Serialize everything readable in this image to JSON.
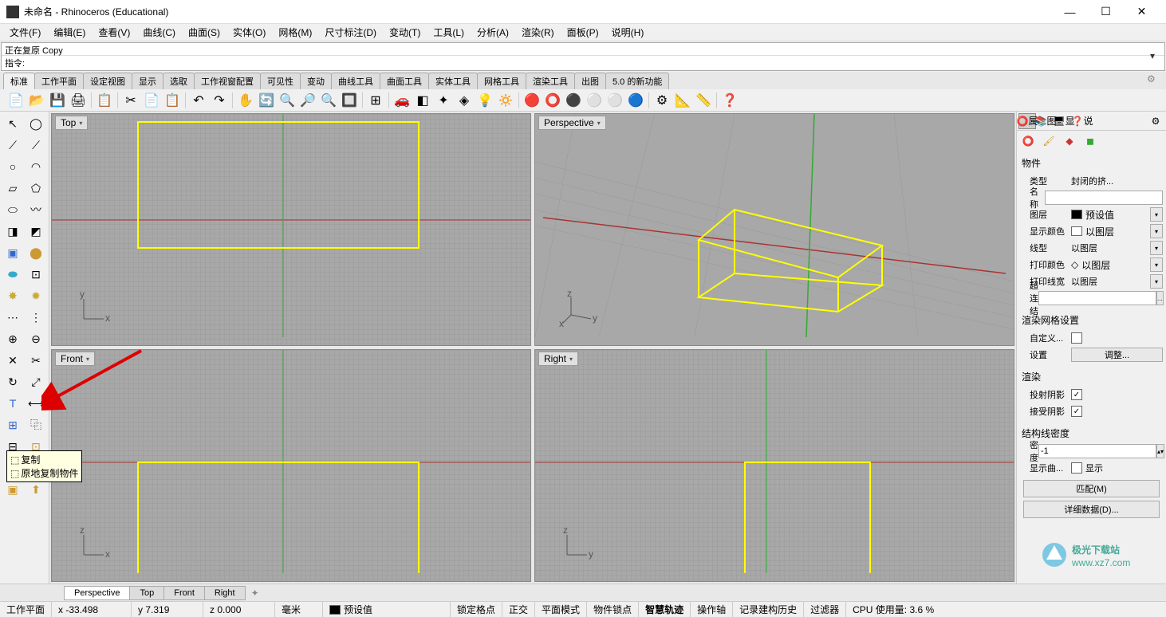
{
  "window": {
    "title": "未命名 - Rhinoceros (Educational)",
    "min": "—",
    "max": "☐",
    "close": "✕"
  },
  "menu": {
    "file": "文件(F)",
    "edit": "编辑(E)",
    "view": "查看(V)",
    "curve": "曲线(C)",
    "surface": "曲面(S)",
    "solid": "实体(O)",
    "mesh": "网格(M)",
    "dimension": "尺寸标注(D)",
    "transform": "变动(T)",
    "tools": "工具(L)",
    "analyze": "分析(A)",
    "render": "渲染(R)",
    "panels": "面板(P)",
    "help": "说明(H)"
  },
  "command": {
    "history": "正在复原 Copy",
    "prompt": "指令:"
  },
  "tabs": {
    "standard": "标准",
    "cplane": "工作平面",
    "setview": "设定视图",
    "display": "显示",
    "select": "选取",
    "viewport": "工作视窗配置",
    "visibility": "可见性",
    "transform": "变动",
    "curvetools": "曲线工具",
    "surfacetools": "曲面工具",
    "solidtools": "实体工具",
    "meshtools": "网格工具",
    "rendertools": "渲染工具",
    "drafting": "出图",
    "newfeatures": "5.0 的新功能"
  },
  "viewports": {
    "top": "Top",
    "perspective": "Perspective",
    "front": "Front",
    "right": "Right"
  },
  "tooltip": {
    "copy": "复制",
    "copyinplace": "原地复制物件"
  },
  "panel_tabs": {
    "properties": "属",
    "layers": "图",
    "display": "显",
    "help": "说"
  },
  "properties": {
    "object": "物件",
    "type": "类型",
    "type_value": "封闭的挤...",
    "name": "名称",
    "layer": "图层",
    "layer_value": "预设值",
    "display_color": "显示颜色",
    "display_color_value": "以图层",
    "linetype": "线型",
    "linetype_value": "以图层",
    "print_color": "打印颜色",
    "print_color_value": "以图层",
    "print_width": "打印线宽",
    "print_width_value": "以图层",
    "hyperlink": "超连结",
    "render_mesh_header": "渲染网格设置",
    "custom": "自定义...",
    "settings": "设置",
    "adjust": "调整...",
    "render_header": "渲染",
    "cast_shadows": "投射阴影",
    "receive_shadows": "接受阴影",
    "isocurve_header": "结构线密度",
    "density": "密度",
    "density_value": "-1",
    "show_curve": "显示曲...",
    "show": "显示",
    "match": "匹配(M)",
    "details": "详细数据(D)..."
  },
  "bottom_tabs": {
    "perspective": "Perspective",
    "top": "Top",
    "front": "Front",
    "right": "Right"
  },
  "statusbar": {
    "cplane": "工作平面",
    "x": "x -33.498",
    "y": "y 7.319",
    "z": "z 0.000",
    "units": "毫米",
    "layer": "预设值",
    "gridsnap": "锁定格点",
    "ortho": "正交",
    "planar": "平面模式",
    "osnap": "物件锁点",
    "smarttrack": "智慧轨迹",
    "gumball": "操作轴",
    "history": "记录建构历史",
    "filter": "过滤器",
    "cpu": "CPU 使用量: 3.6 %"
  },
  "watermark": {
    "name": "极光下载站",
    "url": "www.xz7.com"
  }
}
